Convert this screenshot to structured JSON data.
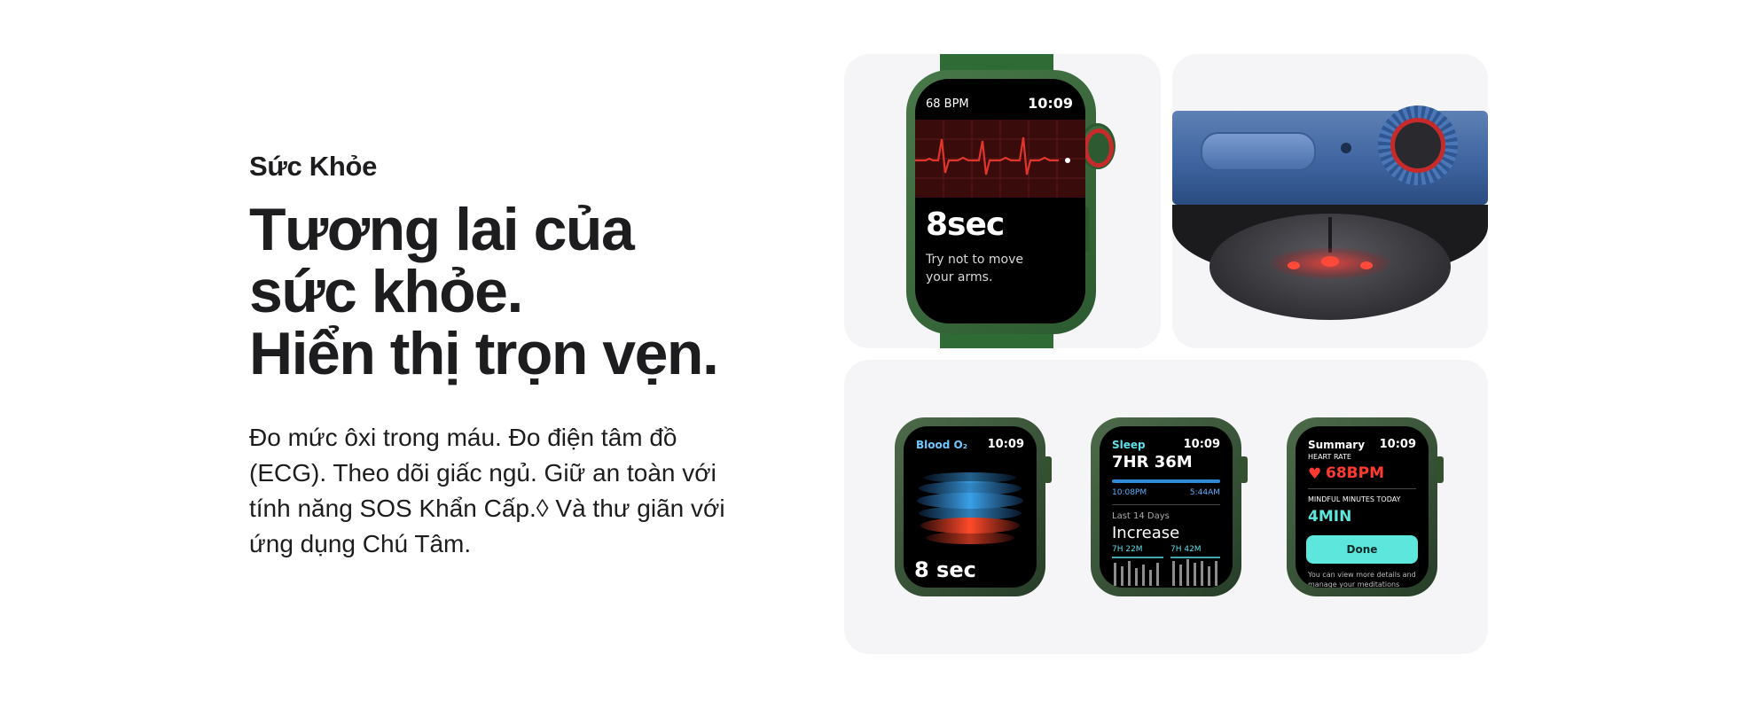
{
  "section": {
    "eyebrow": "Sức Khỏe",
    "headline_line1": "Tương lai của",
    "headline_line2": "sức khỏe.",
    "headline_line3": "Hiển thị trọn vẹn.",
    "body": "Đo mức ôxi trong máu. Đo điện tâm đồ (ECG). Theo dõi giấc ngủ. Giữ an toàn với tính năng SOS Khẩn Cấp.◊ Và thư giãn với ứng dụng Chú Tâm."
  },
  "ecg_watch": {
    "bpm": "68 BPM",
    "time": "10:09",
    "seconds": "8sec",
    "hint_line1": "Try not to move",
    "hint_line2": "your arms."
  },
  "blood_oxygen_watch": {
    "title": "Blood O₂",
    "time": "10:09",
    "seconds": "8 sec"
  },
  "sleep_watch": {
    "title": "Sleep",
    "time": "10:09",
    "duration": "7HR 36M",
    "start": "10:08PM",
    "end": "5:44AM",
    "period": "Last 14 Days",
    "trend": "Increase",
    "avg_left": "7H 22M",
    "avg_right": "7H 42M"
  },
  "summary_watch": {
    "title": "Summary",
    "time": "10:09",
    "heart_rate_label": "HEART RATE",
    "heart_rate_value": "68BPM",
    "mindful_label": "MINDFUL MINUTES TODAY",
    "mindful_value": "4MIN",
    "done_label": "Done",
    "footer": "You can view more details and manage your meditations"
  },
  "colors": {
    "accent_green": "#2f6b34",
    "ecg_red": "#e0352b",
    "summary_cyan": "#5ce6dc",
    "heart_red": "#ff3b30"
  }
}
